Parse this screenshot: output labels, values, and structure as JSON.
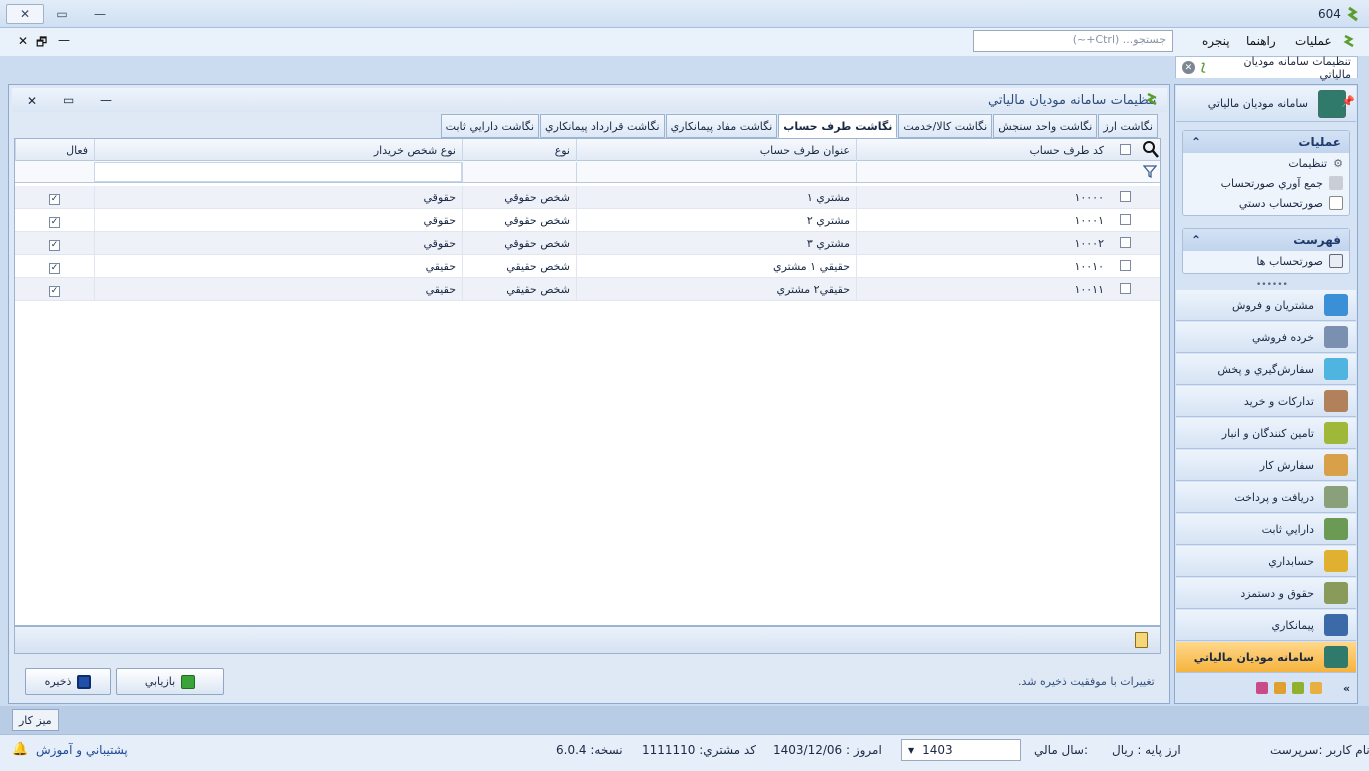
{
  "window": {
    "title": "604",
    "close": "✕",
    "restore": "▭",
    "minimize": "—"
  },
  "menu": {
    "items": [
      "عمليات",
      "راهنما",
      "پنجره"
    ],
    "mdi_close": "✕",
    "mdi_restore": "🗗",
    "mdi_min": "—"
  },
  "search": {
    "placeholder": "جستجو... (Ctrl+~)"
  },
  "doc_tab": {
    "label": "تنظيمات سامانه موديان مالياتي"
  },
  "panel": {
    "title": "تنظيمات سامانه موديان مالياتي"
  },
  "tabs": [
    "نگاشت ارز",
    "نگاشت واحد سنجش",
    "نگاشت کالا/خدمت",
    "نگاشت طرف حساب",
    "نگاشت مفاد پيمانکاري",
    "نگاشت قرارداد پيمانکاري",
    "نگاشت دارايي ثابت"
  ],
  "grid": {
    "headers": {
      "code": "کد طرف حساب",
      "title": "عنوان طرف حساب",
      "type": "نوع",
      "buyer_type": "نوع شخص خريدار",
      "active": "فعال"
    },
    "rows": [
      {
        "code": "۱۰۰۰۰",
        "title": "مشتري ۱",
        "type": "شخص حقوقي",
        "buyer_type": "حقوقي",
        "active": "✓"
      },
      {
        "code": "۱۰۰۰۱",
        "title": "مشتري ۲",
        "type": "شخص حقوقي",
        "buyer_type": "حقوقي",
        "active": "✓"
      },
      {
        "code": "۱۰۰۰۲",
        "title": "مشتري ۳",
        "type": "شخص حقوقي",
        "buyer_type": "حقوقي",
        "active": "✓"
      },
      {
        "code": "۱۰۰۱۰",
        "title": "حقيقي ۱ مشتري",
        "type": "شخص حقيقي",
        "buyer_type": "حقيقي",
        "active": "✓"
      },
      {
        "code": "۱۰۰۱۱",
        "title": "حقيقي۲ مشتري",
        "type": "شخص حقيقي",
        "buyer_type": "حقيقي",
        "active": "✓"
      }
    ]
  },
  "actions": {
    "save": "ذخيره",
    "reload": "بازيابي",
    "status": "تغييرات با موفقيت ذخيره شد."
  },
  "sidebar": {
    "title": "سامانه موديان مالياتي",
    "operations": {
      "title": "عمليات",
      "items": [
        "تنظيمات",
        "جمع آوري صورتحساب",
        "صورتحساب دستي"
      ]
    },
    "list": {
      "title": "فهرست",
      "items": [
        "صورتحساب ها"
      ]
    },
    "modules": [
      {
        "label": "مشتريان و فروش",
        "color": "#3b8fd6"
      },
      {
        "label": "خرده فروشي",
        "color": "#7b8fb0"
      },
      {
        "label": "سفارش‌گيري و پخش",
        "color": "#4fb4e0"
      },
      {
        "label": "تدارکات و خريد",
        "color": "#b0815a"
      },
      {
        "label": "تامين کنندگان و انبار",
        "color": "#a0b83a"
      },
      {
        "label": "سفارش کار",
        "color": "#d9a04a"
      },
      {
        "label": "دريافت و پرداخت",
        "color": "#8aa07a"
      },
      {
        "label": "دارايي ثابت",
        "color": "#6b9a55"
      },
      {
        "label": "حسابداري",
        "color": "#e0b030"
      },
      {
        "label": "حقوق و دستمزد",
        "color": "#8a9a5a"
      },
      {
        "label": "پيمانکاري",
        "color": "#3c6aa8"
      },
      {
        "label": "سامانه موديان مالياتي",
        "color": "#2f7a6a"
      }
    ]
  },
  "taskbar": {
    "desk": "ميز کار"
  },
  "status": {
    "user": "نام کاربر :سرپرست",
    "currency": "ارز پايه :   ريال",
    "fiscal_label": "سال مالي:",
    "fiscal_year": "1403",
    "today": "امروز :   1403/12/06",
    "customer": "کد مشتري:   1111110",
    "version": "نسخه:   6.0.4",
    "support": "پشتيباني و آموزش"
  }
}
